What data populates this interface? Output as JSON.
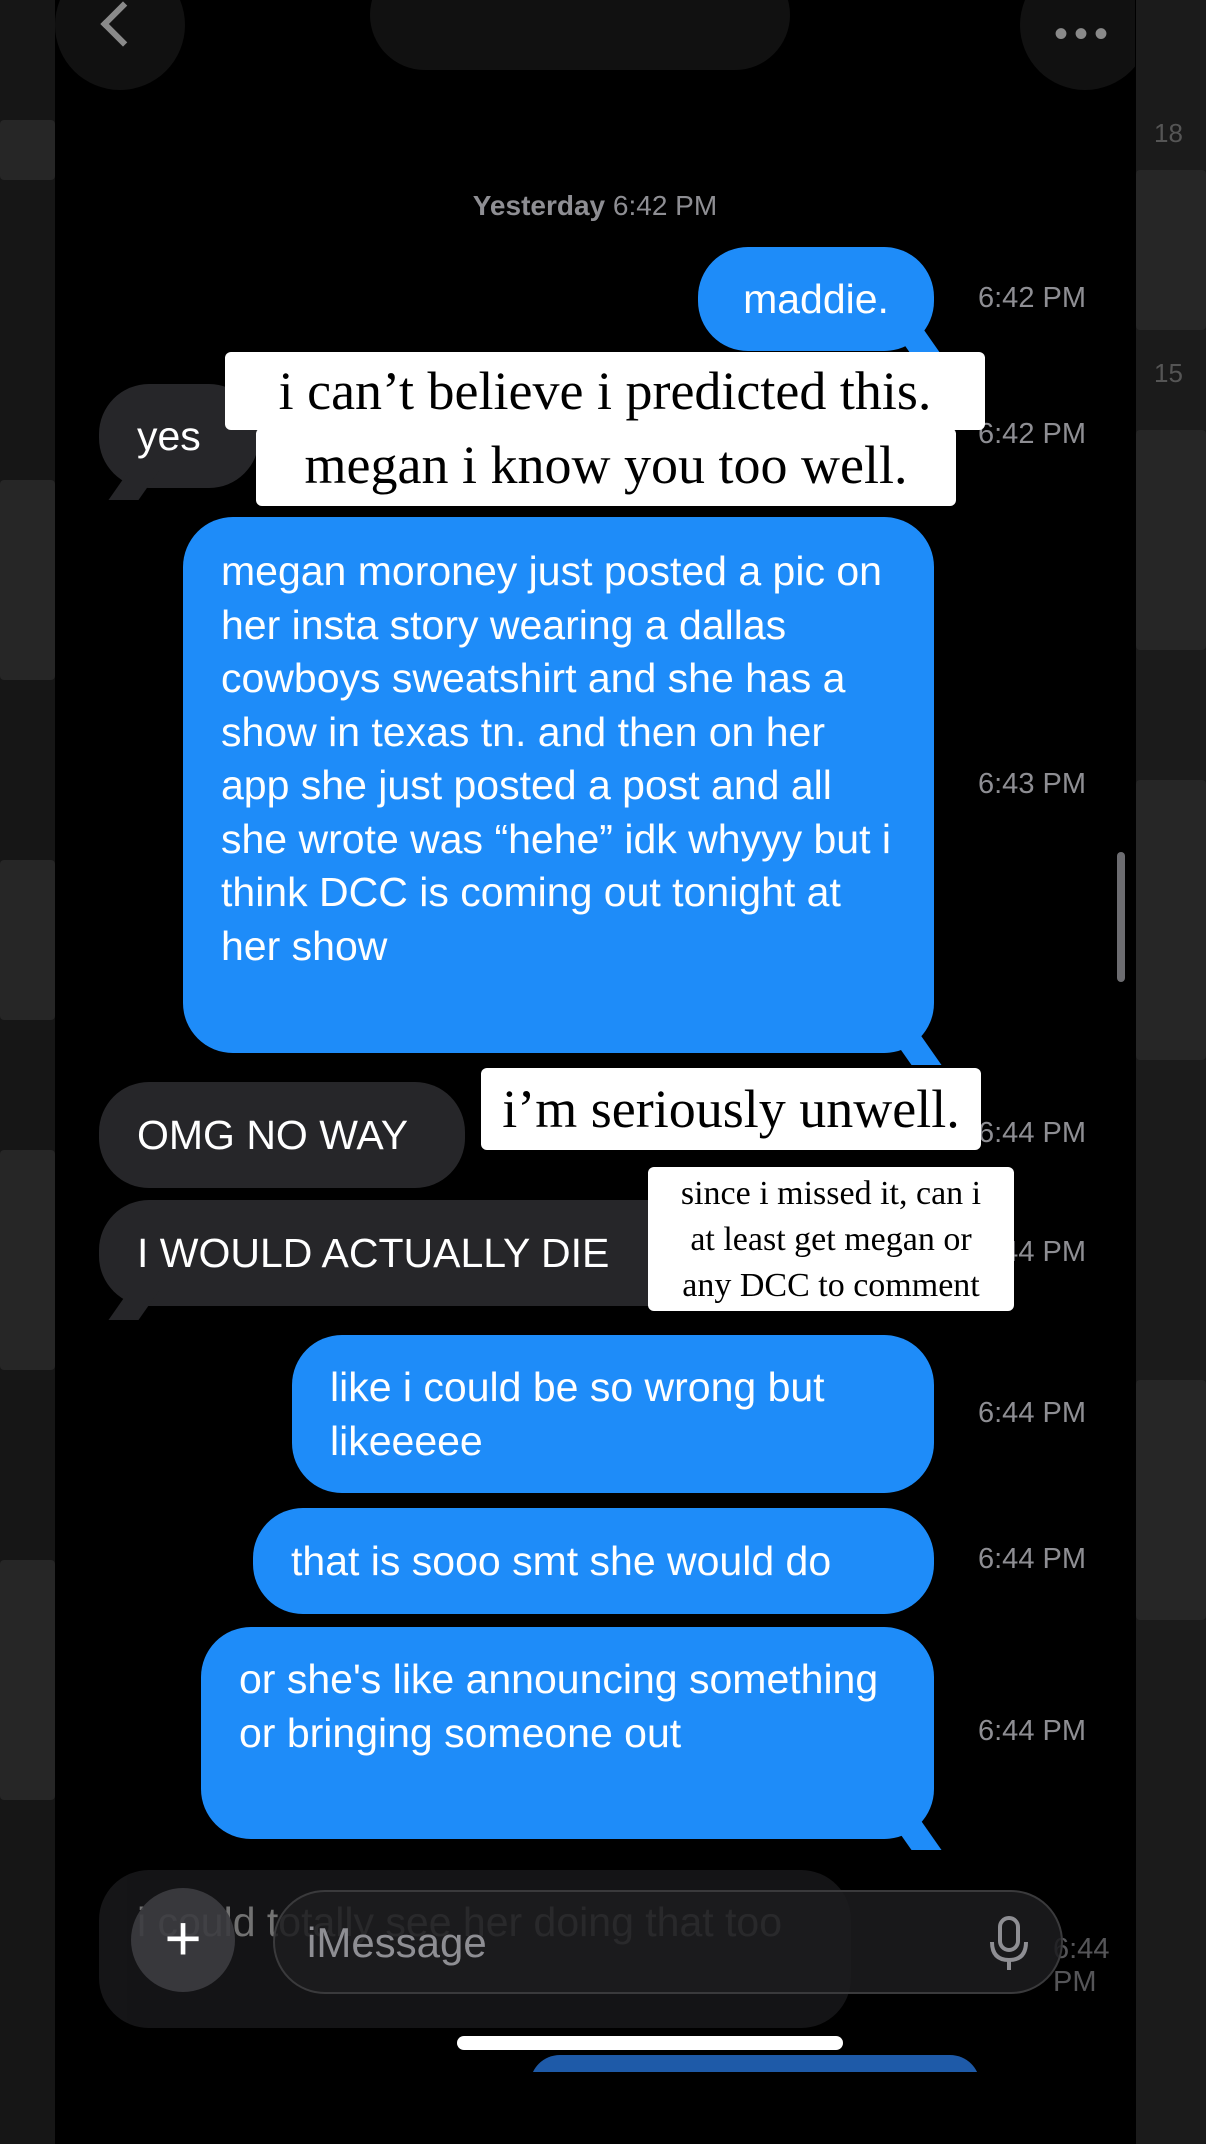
{
  "header": {
    "timestamp_day": "Yesterday",
    "timestamp_time": "6:42 PM"
  },
  "messages": [
    {
      "id": "m1",
      "dir": "out",
      "text": "maddie.",
      "time": "6:42 PM"
    },
    {
      "id": "m2",
      "dir": "in",
      "text": "yes",
      "time": "6:42 PM"
    },
    {
      "id": "m3",
      "dir": "out",
      "text": "megan moroney just posted a pic on her insta story wearing a dallas cowboys sweatshirt and she has a show in texas tn. and then on her app she just posted a post and all she wrote was “hehe” idk whyyy but i think DCC is coming out tonight at her show",
      "time": "6:43 PM"
    },
    {
      "id": "m4",
      "dir": "in",
      "text": "OMG NO WAY",
      "time": "6:44 PM"
    },
    {
      "id": "m5",
      "dir": "in",
      "text": "I WOULD ACTUALLY DIE",
      "time": "6:44 PM"
    },
    {
      "id": "m6",
      "dir": "out",
      "text": "like i could be so wrong but likeeeee",
      "time": "6:44 PM"
    },
    {
      "id": "m7",
      "dir": "out",
      "text": "that is sooo smt she would do",
      "time": "6:44 PM"
    },
    {
      "id": "m8",
      "dir": "out",
      "text": "or she's like announcing something or bringing someone out",
      "time": "6:44 PM"
    },
    {
      "id": "m9",
      "dir": "in",
      "text": "i could totally see her doing that too",
      "time": "6:44 PM"
    }
  ],
  "overlays": {
    "caption1_line1": "i can’t believe i predicted this.",
    "caption1_line2": "megan i know you too well.",
    "caption2": "i’m seriously unwell.",
    "caption3_line1": "since i missed it, can i",
    "caption3_line2": "at least get megan or",
    "caption3_line3": "any DCC to comment"
  },
  "input": {
    "placeholder": "iMessage",
    "plus_label": "+"
  },
  "icons": {
    "back": "chevron-left-icon",
    "more": "ellipsis-icon",
    "plus": "plus-icon",
    "mic": "microphone-icon"
  },
  "background_side": {
    "right_time_1": "18",
    "right_time_2": "15"
  },
  "colors": {
    "outgoing_bubble": "#1e8cf9",
    "incoming_bubble": "#262629",
    "timestamp": "#8e8e93",
    "background": "#000000"
  }
}
